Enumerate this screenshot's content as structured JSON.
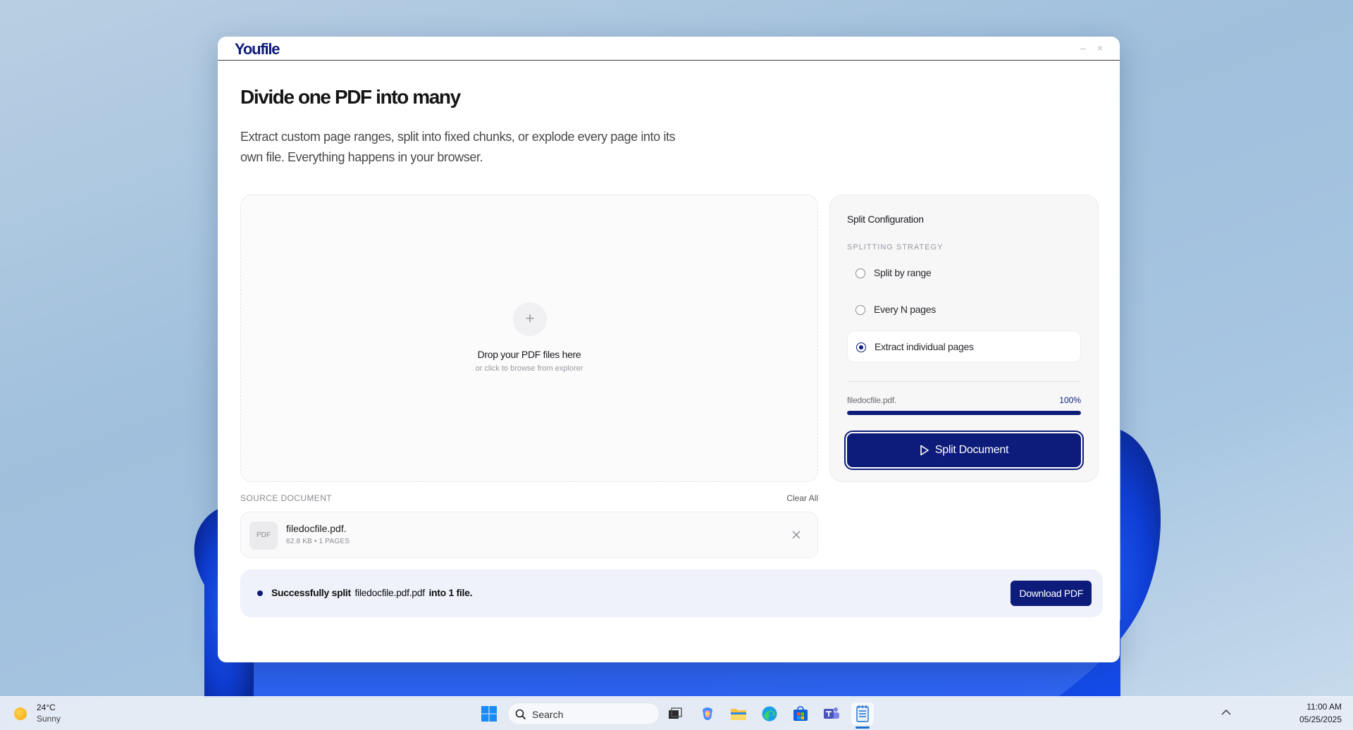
{
  "app": {
    "logo": "Youfile",
    "minimize_glyph": "–",
    "close_glyph": "×"
  },
  "hero": {
    "title": "Divide one PDF into many",
    "subtitle": "Extract custom page ranges, split into fixed chunks, or explode every page into its own file. Everything happens in your browser."
  },
  "dropzone": {
    "plus_glyph": "+",
    "title": "Drop your PDF files here",
    "subtitle": "or click to browse from explorer"
  },
  "source": {
    "label": "SOURCE DOCUMENT",
    "clear_label": "Clear All",
    "file": {
      "badge": "PDF",
      "name": "filedocfile.pdf.",
      "meta": "62.8 KB • 1 PAGES"
    }
  },
  "config": {
    "title": "Split Configuration",
    "section_label": "SPLITTING STRATEGY",
    "options": [
      {
        "label": "Split by range",
        "selected": false
      },
      {
        "label": "Every N pages",
        "selected": false
      },
      {
        "label": "Extract individual pages",
        "selected": true
      }
    ],
    "progress": {
      "file": "filedocfile.pdf.",
      "percent_label": "100%",
      "fraction": 1.0
    },
    "split_button": "Split Document"
  },
  "success": {
    "prefix": "Successfully split",
    "filename": "filedocfile.pdf.pdf",
    "suffix": "into 1 file.",
    "download_label": "Download PDF"
  },
  "taskbar": {
    "weather_temp": "24°C",
    "weather_desc": "Sunny",
    "search_label": "Search",
    "time": "11:00 AM",
    "date": "05/25/2025",
    "icons": [
      "start-icon",
      "task-view-icon",
      "copilot-icon",
      "file-explorer-icon",
      "edge-icon",
      "store-icon",
      "teams-icon",
      "notepad-icon"
    ]
  },
  "colors": {
    "accent": "#0d1c7a",
    "success_bg": "#eff1fb"
  }
}
